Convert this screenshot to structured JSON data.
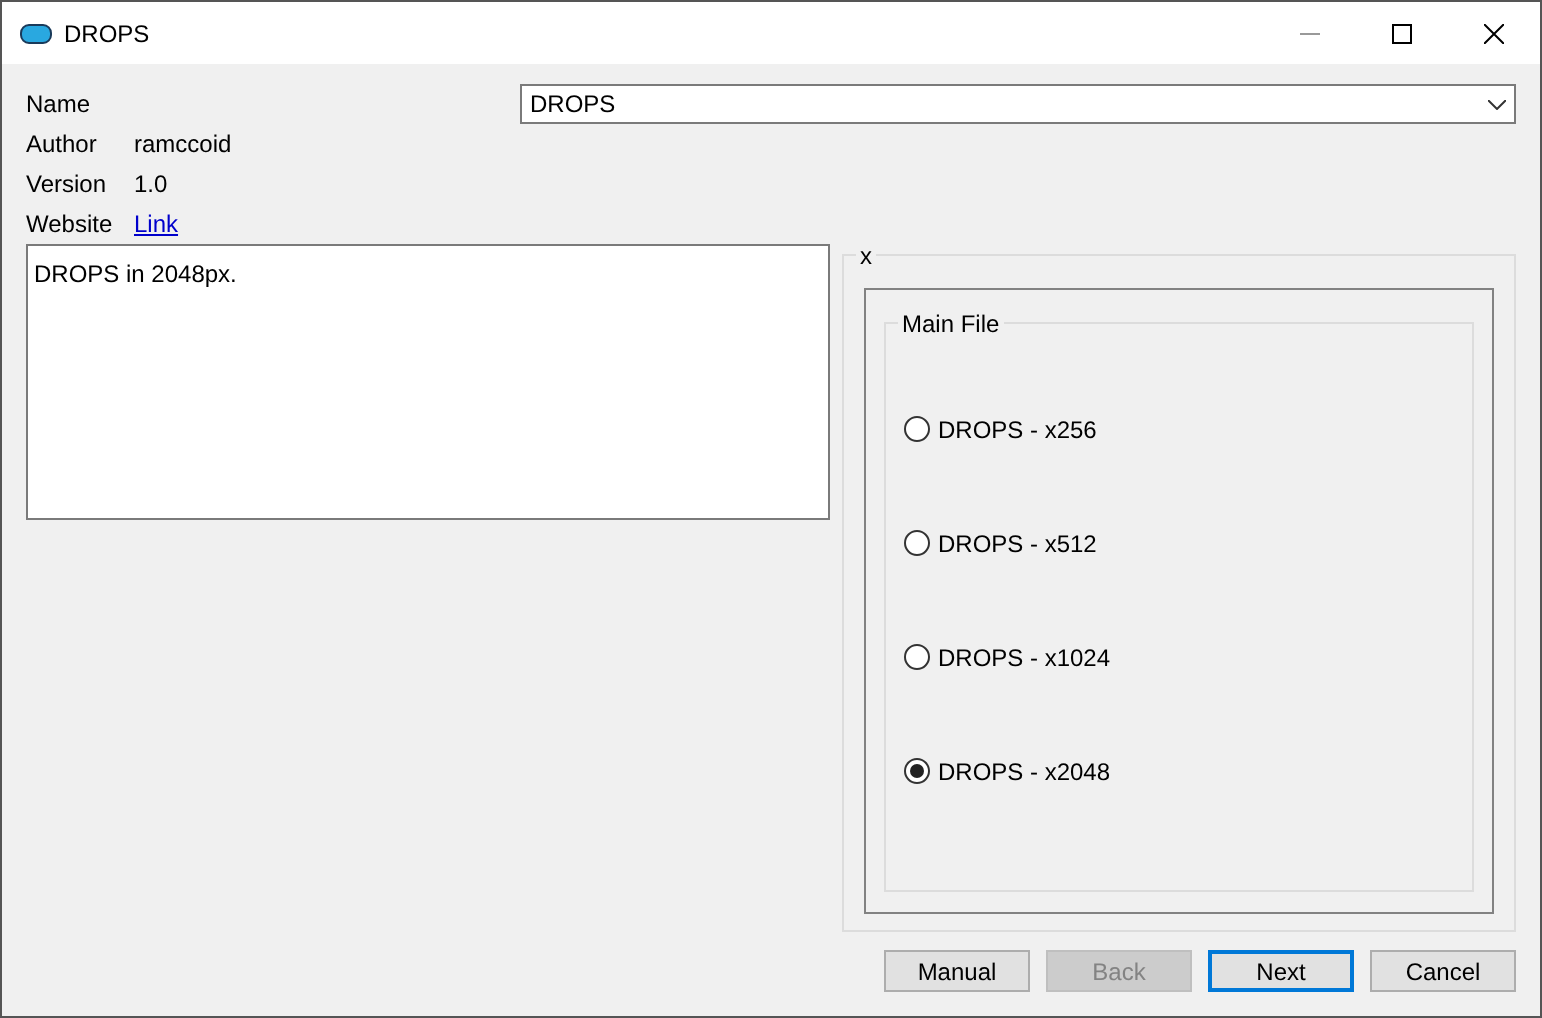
{
  "window": {
    "title": "DROPS"
  },
  "fields": {
    "name": {
      "label": "Name",
      "value": "DROPS"
    },
    "author": {
      "label": "Author",
      "value": "ramccoid"
    },
    "version": {
      "label": "Version",
      "value": "1.0"
    },
    "website": {
      "label": "Website",
      "link": "Link"
    }
  },
  "description": "DROPS in 2048px.",
  "group": {
    "title": "x",
    "inner_title": "Main File",
    "options": [
      {
        "label": "DROPS - x256",
        "selected": false
      },
      {
        "label": "DROPS - x512",
        "selected": false
      },
      {
        "label": "DROPS - x1024",
        "selected": false
      },
      {
        "label": "DROPS - x2048",
        "selected": true
      }
    ]
  },
  "buttons": [
    {
      "label": "Manual",
      "disabled": false,
      "default": false
    },
    {
      "label": "Back",
      "disabled": true,
      "default": false
    },
    {
      "label": "Next",
      "disabled": false,
      "default": true
    },
    {
      "label": "Cancel",
      "disabled": false,
      "default": false
    }
  ]
}
